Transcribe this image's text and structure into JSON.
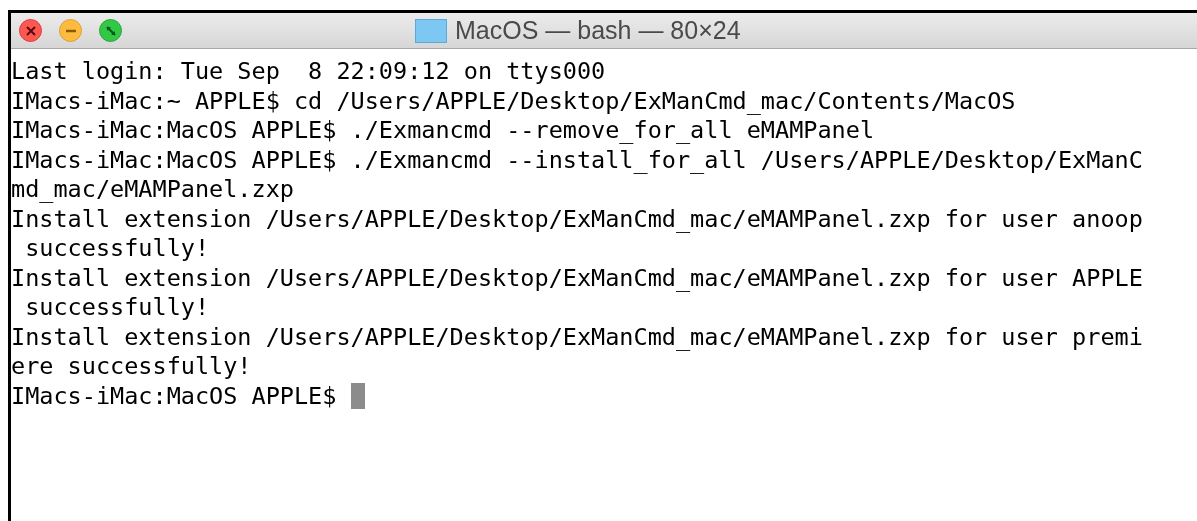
{
  "window": {
    "title": "MacOS — bash — 80×24"
  },
  "terminal": {
    "lines": [
      "Last login: Tue Sep  8 22:09:12 on ttys000",
      "IMacs-iMac:~ APPLE$ cd /Users/APPLE/Desktop/ExManCmd_mac/Contents/MacOS",
      "IMacs-iMac:MacOS APPLE$ ./Exmancmd --remove_for_all eMAMPanel",
      "IMacs-iMac:MacOS APPLE$ ./Exmancmd --install_for_all /Users/APPLE/Desktop/ExManC",
      "md_mac/eMAMPanel.zxp",
      "Install extension /Users/APPLE/Desktop/ExManCmd_mac/eMAMPanel.zxp for user anoop",
      " successfully!",
      "Install extension /Users/APPLE/Desktop/ExManCmd_mac/eMAMPanel.zxp for user APPLE",
      " successfully!",
      "Install extension /Users/APPLE/Desktop/ExManCmd_mac/eMAMPanel.zxp for user premi",
      "ere successfully!",
      "IMacs-iMac:MacOS APPLE$ "
    ],
    "cursor": true
  }
}
